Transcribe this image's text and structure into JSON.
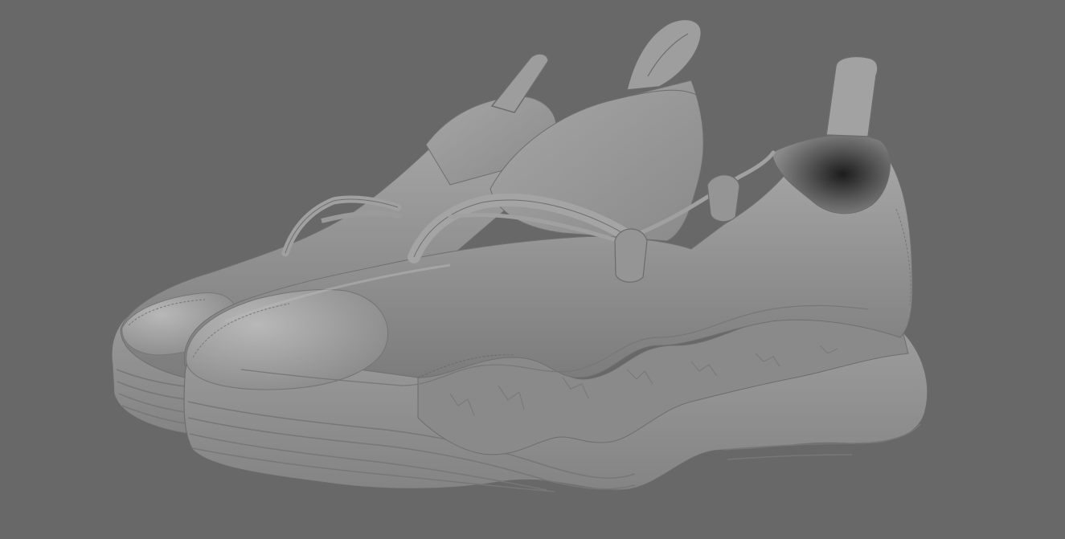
{
  "scene": {
    "background_color": "#686868",
    "model_base_color": "#8e8e8e",
    "model_highlight_color": "#b4b4b4",
    "model_shadow_color": "#5c5c5c",
    "seam_color": "#6e6e6e",
    "subject": "pair-of-untextured-3d-sneakers"
  }
}
